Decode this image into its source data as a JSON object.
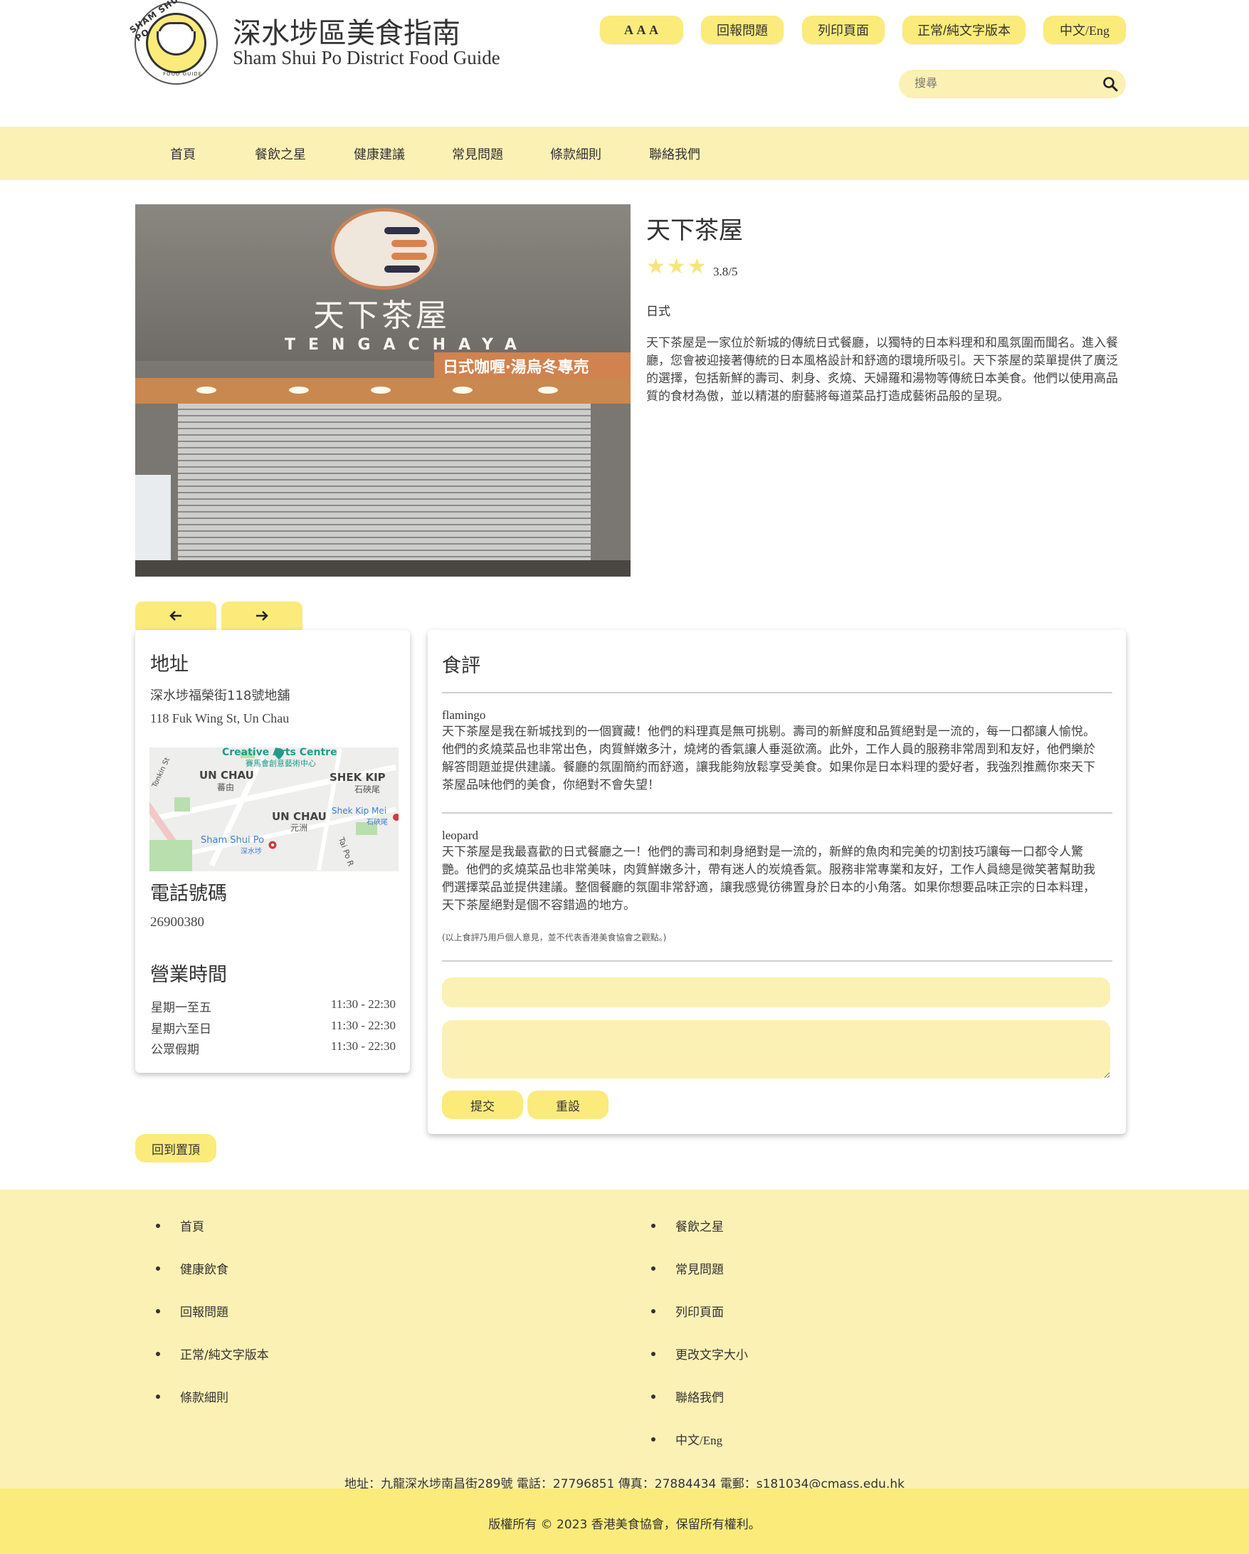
{
  "header": {
    "logo_text": "SHAM SHUI PO",
    "logo_subtext": "FOOD GUIDE",
    "title_zh": "深水埗區美食指南",
    "title_en": "Sham Shui Po District Food Guide",
    "buttons": {
      "font_size": "A A A",
      "report": "回報問題",
      "print": "列印頁面",
      "text_version": "正常/純文字版本",
      "language": "中文/Eng"
    },
    "search": {
      "placeholder": "搜尋",
      "icon": "search-icon"
    }
  },
  "nav": {
    "items": [
      {
        "label": "首頁"
      },
      {
        "label": "餐飲之星"
      },
      {
        "label": "健康建議"
      },
      {
        "label": "常見問題"
      },
      {
        "label": "條款細則"
      },
      {
        "label": "聯絡我們"
      }
    ]
  },
  "restaurant": {
    "photo": {
      "sign_name": "天下茶屋",
      "sign_en": "TENGACHAYA",
      "banner": "日式咖喱‧湯烏冬專売"
    },
    "name": "天下茶屋",
    "rating": 3.8,
    "rating_text": "3.8/5",
    "stars_shown": 3,
    "cuisine": "日式",
    "description": "天下茶屋是一家位於新城的傳統日式餐廳，以獨特的日本料理和和風氛圍而聞名。進入餐廳，您會被迎接著傳統的日本風格設計和舒適的環境所吸引。天下茶屋的菜單提供了廣泛的選擇，包括新鮮的壽司、刺身、炙燒、天婦羅和湯物等傳統日本美食。他們以使用高品質的食材為傲，並以精湛的廚藝將每道菜品打造成藝術品般的呈現。",
    "prev_icon": "arrow-left-icon",
    "next_icon": "arrow-right-icon"
  },
  "info": {
    "address_heading": "地址",
    "address_zh": "深水埗福榮街118號地舖",
    "address_en": "118 Fuk Wing St, Un Chau",
    "map": {
      "creative_arts": "Creative Arts Centre",
      "creative_arts_zh": "賽馬會創意藝術中心",
      "un_chau": "UN CHAU",
      "un_chau_zh": "元洲",
      "shek_kip": "SHEK KIP",
      "shek_kip_zh": "石硤尾",
      "shek_kip_mei": "Shek Kip Mei",
      "shek_kip_mei_zh": "石硤尾",
      "ssp": "Sham Shui Po",
      "ssp_zh": "深水埗",
      "un_chau_top": "UN CHAU",
      "un_chau_top_zh": "蕃由",
      "tonkin": "Tonkin St",
      "tai_po": "Tai Po R"
    },
    "phone_heading": "電話號碼",
    "phone": "26900380",
    "hours_heading": "營業時間",
    "hours": [
      {
        "day": "星期一至五",
        "time": "11:30 - 22:30"
      },
      {
        "day": "星期六至日",
        "time": "11:30 - 22:30"
      },
      {
        "day": "公眾假期",
        "time": "11:30 - 22:30"
      }
    ]
  },
  "reviews": {
    "heading": "食評",
    "items": [
      {
        "author": "flamingo",
        "text": "天下茶屋是我在新城找到的一個寶藏！他們的料理真是無可挑剔。壽司的新鮮度和品質絕對是一流的，每一口都讓人愉悅。他們的炙燒菜品也非常出色，肉質鮮嫩多汁，燒烤的香氣讓人垂涎欲滴。此外，工作人員的服務非常周到和友好，他們樂於解答問題並提供建議。餐廳的氛圍簡約而舒適，讓我能夠放鬆享受美食。如果你是日本料理的愛好者，我強烈推薦你來天下茶屋品味他們的美食，你絕對不會失望！"
      },
      {
        "author": "leopard",
        "text": "天下茶屋是我最喜歡的日式餐廳之一！他們的壽司和刺身絕對是一流的，新鮮的魚肉和完美的切割技巧讓每一口都令人驚艷。他們的炙燒菜品也非常美味，肉質鮮嫩多汁，帶有迷人的炭燒香氣。服務非常專業和友好，工作人員總是微笑著幫助我們選擇菜品並提供建議。整個餐廳的氛圍非常舒適，讓我感覺彷彿置身於日本的小角落。如果你想要品味正宗的日本料理，天下茶屋絕對是個不容錯過的地方。"
      }
    ],
    "disclaimer": "(以上食評乃用戶個人意見，並不代表香港美食協會之觀點。)",
    "name_value": "",
    "comment_value": "",
    "submit": "提交",
    "reset": "重設"
  },
  "back_to_top": "回到置頂",
  "footer": {
    "left": [
      "首頁",
      "健康飲食",
      "回報問題",
      "正常/純文字版本",
      "條款細則"
    ],
    "right": [
      "餐飲之星",
      "常見問題",
      "列印頁面",
      "更改文字大小",
      "聯絡我們",
      "中文/Eng"
    ],
    "contact": "地址：九龍深水埗南昌街289號 電話：27796851 傳真：27884434 電郵：s181034@cmass.edu.hk",
    "copyright": "版權所有 © 2023 香港美食協會，保留所有權利。"
  },
  "colors": {
    "accent": "#fbeb7a",
    "accent_light": "#fcf1b4",
    "star": "#f6e57a"
  }
}
